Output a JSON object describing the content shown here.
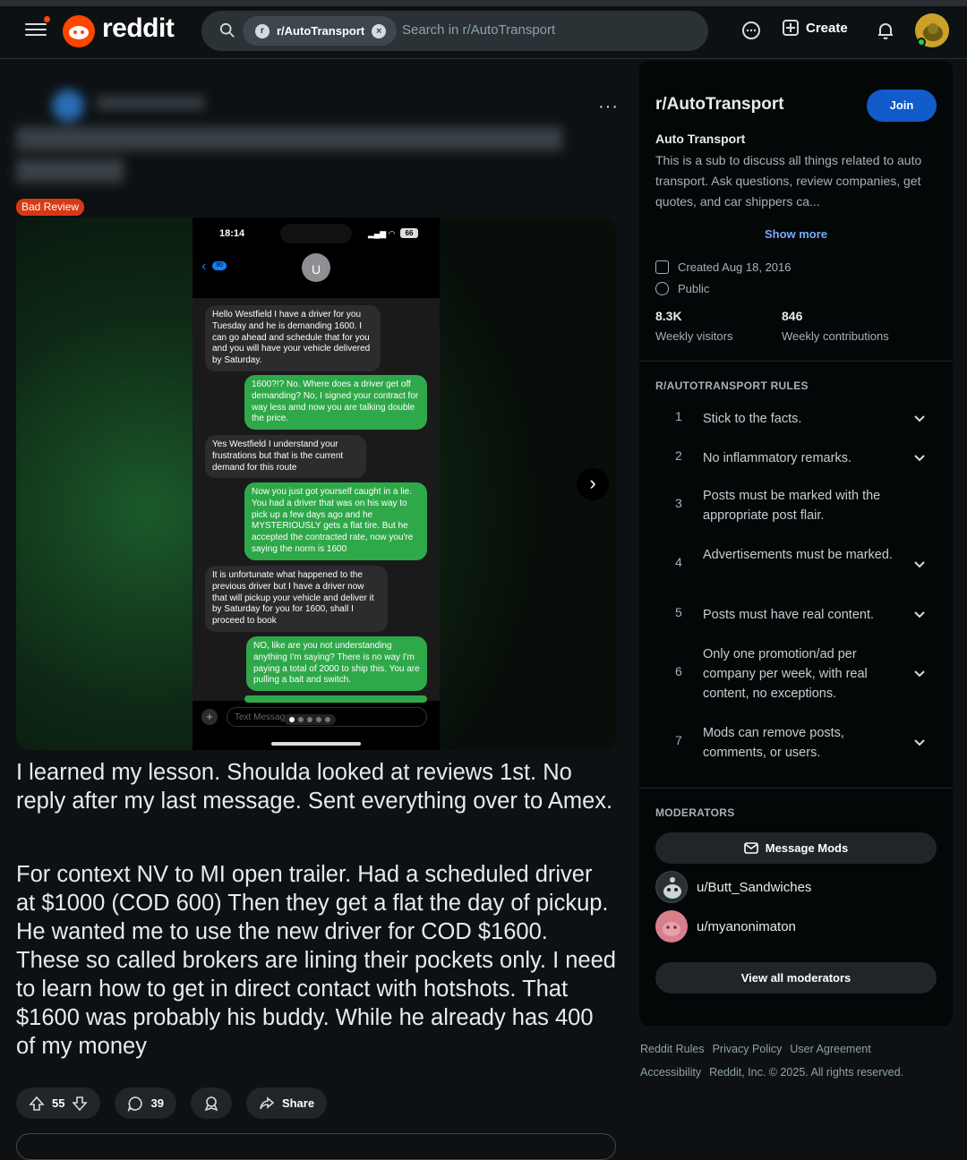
{
  "header": {
    "logo_text": "reddit",
    "search_chip": "r/AutoTransport",
    "search_placeholder": "Search in r/AutoTransport",
    "create_label": "Create"
  },
  "post": {
    "flair": "Bad Review",
    "body_p1": "I learned my lesson. Shoulda looked at reviews 1st. No reply after my last message. Sent everything over to Amex.",
    "body_p2": "For context NV to MI open trailer. Had a scheduled driver at $1000 (COD 600) Then they get a flat the day of pickup. He wanted me to use the new driver for COD $1600. These so called brokers are lining their pockets only. I need to learn how to get in direct contact with hotshots. That $1600 was probably his buddy. While he already has 400 of my money",
    "upvotes": "55",
    "comments": "39",
    "share_label": "Share",
    "more_label": "···"
  },
  "screenshot": {
    "time": "18:14",
    "battery": "66",
    "back_badge": "90",
    "contact_initial": "U",
    "input_placeholder": "Text Message",
    "messages": [
      {
        "dir": "in",
        "text": "Hello Westfield I have a driver for you Tuesday and he is demanding 1600. I can go ahead and schedule that for you and you will have your vehicle delivered by Saturday."
      },
      {
        "dir": "out",
        "text": "1600?!? No. Where does a driver get off demanding? No, I signed your contract for way less amd now you are talking double the price."
      },
      {
        "dir": "in",
        "text": "Yes Westfield I understand your frustrations but that is the current demand for this route"
      },
      {
        "dir": "out",
        "text": "Now you just got yourself caught in a lie. You had a driver that was on his way to pick up a few days ago and he MYSTERIOUSLY gets a flat tire. But he accepted the contracted rate, now you're saying the norm is 1600"
      },
      {
        "dir": "in",
        "text": "It is unfortunate what happened to the previous driver but I have a driver now that will pickup your vehicle and deliver it by Saturday for you for 1600, shall I proceed to book"
      },
      {
        "dir": "out",
        "text": "NO, like are you not understanding anything I'm saying? There is no way I'm paying a total of 2000 to ship this. You are pulling a bait and switch."
      }
    ]
  },
  "sidebar": {
    "name": "r/AutoTransport",
    "join_label": "Join",
    "title": "Auto Transport",
    "description": "This is a sub to discuss all things related to auto transport. Ask questions, review companies, get quotes, and car shippers ca...",
    "show_more": "Show more",
    "created": "Created Aug 18, 2016",
    "visibility": "Public",
    "visitors_value": "8.3K",
    "visitors_label": "Weekly visitors",
    "contrib_value": "846",
    "contrib_label": "Weekly contributions",
    "rules_header": "R/AUTOTRANSPORT RULES",
    "rules": [
      {
        "num": "1",
        "text": "Stick to the facts."
      },
      {
        "num": "2",
        "text": "No inflammatory remarks."
      },
      {
        "num": "3",
        "text": "Posts must be marked with the appropriate post flair."
      },
      {
        "num": "4",
        "text": "Advertisements must be marked."
      },
      {
        "num": "5",
        "text": "Posts must have real content."
      },
      {
        "num": "6",
        "text": "Only one promotion/ad per company per week, with real content, no exceptions."
      },
      {
        "num": "7",
        "text": "Mods can remove posts, comments, or users."
      }
    ],
    "mods_header": "MODERATORS",
    "message_mods": "Message Mods",
    "mods": [
      "u/Butt_Sandwiches",
      "u/myanonimaton"
    ],
    "view_all": "View all moderators"
  },
  "footer": {
    "links1": [
      "Reddit Rules",
      "Privacy Policy",
      "User Agreement"
    ],
    "links2": [
      "Accessibility",
      "Reddit, Inc. © 2025. All rights reserved."
    ]
  },
  "colors": {
    "accent": "#ff4500",
    "join": "#115bca",
    "flair": "#d63a14",
    "imessage_out": "#2fa84a"
  }
}
